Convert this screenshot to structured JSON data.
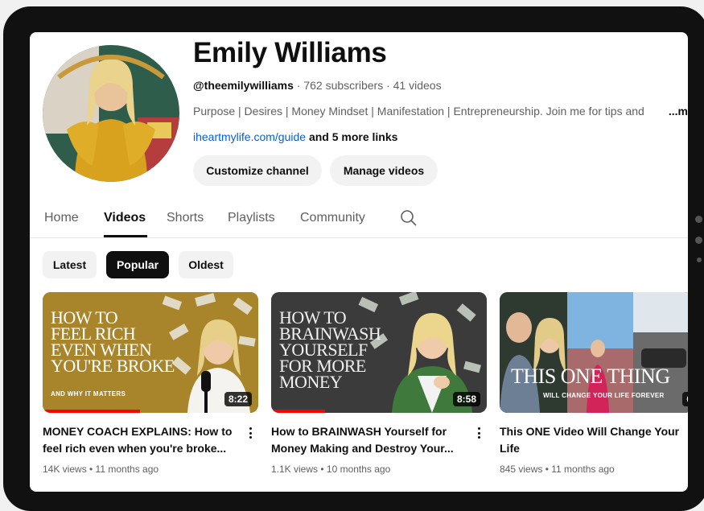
{
  "channel": {
    "name": "Emily Williams",
    "handle": "@theemilywilliams",
    "meta_rest": " · 762 subscribers · 41 videos",
    "description": "Purpose | Desires | Money Mindset | Manifestation | Entrepreneurship. Join me for tips and",
    "description_more": "...m",
    "link": "iheartmylife.com/guide",
    "more_links": " and 5 more links"
  },
  "buttons": {
    "customize": "Customize channel",
    "manage": "Manage videos"
  },
  "tabs": [
    "Home",
    "Videos",
    "Shorts",
    "Playlists",
    "Community"
  ],
  "active_tab": "Videos",
  "chips": [
    "Latest",
    "Popular",
    "Oldest"
  ],
  "active_chip": "Popular",
  "videos": [
    {
      "thumb_text": "HOW TO\nFEEL RICH\nEVEN WHEN\nYOU'RE BROKE",
      "thumb_sub": "AND WHY IT MATTERS",
      "duration": "8:22",
      "progress": 0.45,
      "title": "MONEY COACH EXPLAINS: How to feel rich even when you're broke...",
      "meta": "14K views • 11 months ago"
    },
    {
      "thumb_text": "HOW TO\nBRAINWASH\nYOURSELF\nFOR MORE\nMONEY",
      "duration": "8:58",
      "progress": 0.25,
      "title": "How to BRAINWASH Yourself for Money Making and Destroy Your...",
      "meta": "1.1K views • 10 months ago"
    },
    {
      "thumb_text": "THIS ONE THING",
      "thumb_sub": "WILL CHANGE YOUR LIFE FOREVER",
      "duration": "6",
      "title": "This ONE Video Will Change Your Life",
      "meta": "845 views • 11 months ago"
    }
  ],
  "colors": {
    "link": "#065fd4",
    "accent": "#ff0000",
    "thumb1_bg": "#a8852a",
    "thumb2_bg": "#3d3d3d"
  }
}
